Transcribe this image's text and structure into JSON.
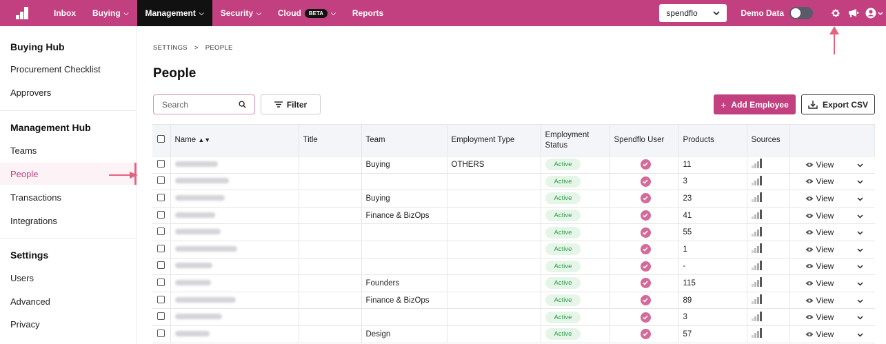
{
  "topbar": {
    "nav": [
      {
        "label": "Inbox",
        "has_chevron": false
      },
      {
        "label": "Buying",
        "has_chevron": true
      },
      {
        "label": "Management",
        "has_chevron": true,
        "active": true
      },
      {
        "label": "Security",
        "has_chevron": true
      },
      {
        "label": "Cloud",
        "has_chevron": true,
        "badge": "BETA"
      },
      {
        "label": "Reports",
        "has_chevron": false
      }
    ],
    "org_select": "spendflo",
    "demo_label": "Demo Data",
    "demo_enabled": false,
    "icons": [
      "gear-icon",
      "megaphone-icon",
      "user-account-icon"
    ]
  },
  "sidebar": {
    "sections": [
      {
        "title": "Buying Hub",
        "items": [
          "Procurement Checklist",
          "Approvers"
        ]
      },
      {
        "title": "Management Hub",
        "items": [
          "Teams",
          "People",
          "Transactions",
          "Integrations"
        ]
      },
      {
        "title": "Settings",
        "items": [
          "Users",
          "Advanced",
          "Privacy"
        ]
      }
    ],
    "active_item": "People"
  },
  "breadcrumb": [
    "SETTINGS",
    ">",
    "PEOPLE"
  ],
  "page_title": "People",
  "search": {
    "placeholder": "Search"
  },
  "buttons": {
    "filter": "Filter",
    "add_employee": "Add Employee",
    "export_csv": "Export CSV"
  },
  "table": {
    "columns": [
      "Name",
      "Title",
      "Team",
      "Employment Type",
      "Employment Status",
      "Spendflo User",
      "Products",
      "Sources"
    ],
    "rows": [
      {
        "team": "Buying",
        "employment_type": "OTHERS",
        "status": "Active",
        "products": "11",
        "action": "View"
      },
      {
        "team": "",
        "employment_type": "",
        "status": "Active",
        "products": "3",
        "action": "View"
      },
      {
        "team": "Buying",
        "employment_type": "",
        "status": "Active",
        "products": "23",
        "action": "View"
      },
      {
        "team": "Finance & BizOps",
        "employment_type": "",
        "status": "Active",
        "products": "41",
        "action": "View"
      },
      {
        "team": "",
        "employment_type": "",
        "status": "Active",
        "products": "55",
        "action": "View"
      },
      {
        "team": "",
        "employment_type": "",
        "status": "Active",
        "products": "1",
        "action": "View"
      },
      {
        "team": "",
        "employment_type": "",
        "status": "Active",
        "products": "-",
        "action": "View"
      },
      {
        "team": "Founders",
        "employment_type": "",
        "status": "Active",
        "products": "115",
        "action": "View"
      },
      {
        "team": "Finance & BizOps",
        "employment_type": "",
        "status": "Active",
        "products": "89",
        "action": "View"
      },
      {
        "team": "",
        "employment_type": "",
        "status": "Active",
        "products": "3",
        "action": "View"
      },
      {
        "team": "Design",
        "employment_type": "",
        "status": "Active",
        "products": "57",
        "action": "View"
      }
    ]
  },
  "colors": {
    "brand": "#c2407f",
    "active_badge_bg": "#e5f6e8",
    "active_badge_text": "#2d9a48",
    "annotation_arrow": "#e3637f"
  }
}
